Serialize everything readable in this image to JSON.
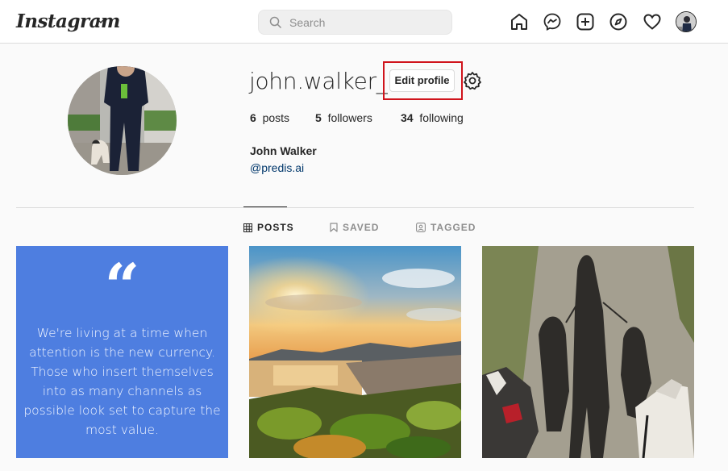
{
  "header": {
    "logo": "Instagram",
    "search_placeholder": "Search",
    "nav_icons": [
      "home-icon",
      "messenger-icon",
      "new-post-icon",
      "explore-icon",
      "activity-heart-icon",
      "profile-avatar"
    ]
  },
  "profile": {
    "username": "john.walker_92",
    "edit_label": "Edit profile",
    "posts_count": "6",
    "posts_label": "posts",
    "followers_count": "5",
    "followers_label": "followers",
    "following_count": "34",
    "following_label": "following",
    "full_name": "John Walker",
    "handle": "@predis.ai"
  },
  "tabs": [
    {
      "label": "POSTS",
      "active": true
    },
    {
      "label": "SAVED",
      "active": false
    },
    {
      "label": "TAGGED",
      "active": false
    }
  ],
  "posts": {
    "quote_text": "We're living at a time when attention is the new currency. Those who insert themselves into as many channels as possible look set to capture the most value.",
    "quote_color": "#4e7ee0"
  },
  "colors": {
    "highlight": "#d0141c",
    "link": "#00376b",
    "border": "#dbdbdb"
  }
}
